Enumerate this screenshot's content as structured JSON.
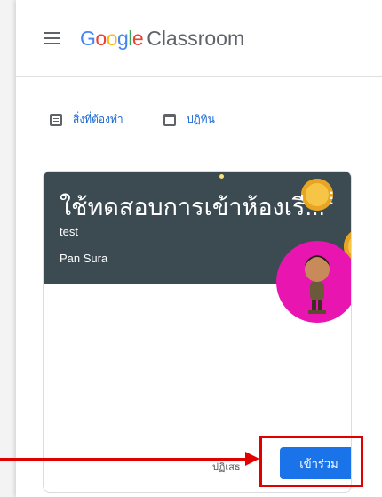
{
  "app": {
    "logo_google": [
      "G",
      "o",
      "o",
      "g",
      "l",
      "e"
    ],
    "logo_product": "Classroom"
  },
  "nav": {
    "todo_label": "สิ่งที่ต้องทำ",
    "calendar_label": "ปฏิทิน"
  },
  "card": {
    "title": "ใช้ทดสอบการเข้าห้องเรี...",
    "section": "test",
    "teacher": "Pan Sura",
    "decline_label": "ปฏิเสธ",
    "join_label": "เข้าร่วม",
    "header_color": "#3c4a52",
    "avatar_color": "#e815b0"
  },
  "annotation": {
    "color": "#e00000"
  },
  "icons": [
    "menu-icon",
    "todo-icon",
    "calendar-icon",
    "more-vert-icon",
    "avatar"
  ]
}
